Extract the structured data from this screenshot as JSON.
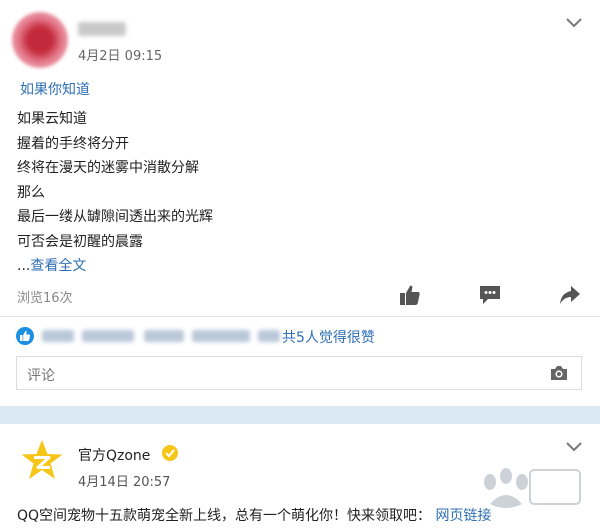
{
  "post1": {
    "timestamp": "4月2日 09:15",
    "title": "如果你知道",
    "lines": [
      "如果云知道",
      "握着的手终将分开",
      "终将在漫天的迷雾中消散分解",
      "那么",
      "最后一缕从罅隙间透出来的光辉",
      "可否会是初醒的晨露"
    ],
    "ellipsis": "...",
    "read_more": "查看全文",
    "views": "浏览16次",
    "likes_summary": "共5人觉得很赞",
    "comment_placeholder": "评论"
  },
  "post2": {
    "author": "官方Qzone",
    "timestamp": "4月14日 20:57",
    "text": "QQ空间宠物十五款萌宠全新上线，总有一个萌化你！快来领取吧：",
    "link": "网页链接"
  },
  "icons": {
    "menu": "chevron-down-icon",
    "like": "thumbs-up-icon",
    "comment": "comment-icon",
    "share": "share-icon",
    "camera": "camera-icon",
    "verified": "verified-badge-icon",
    "logo": "qzone-star-logo"
  },
  "colors": {
    "link": "#2f6fb5",
    "separator": "#dbe9f4",
    "qzone_yellow": "#f5c518",
    "like_badge": "#1d8fe1"
  }
}
